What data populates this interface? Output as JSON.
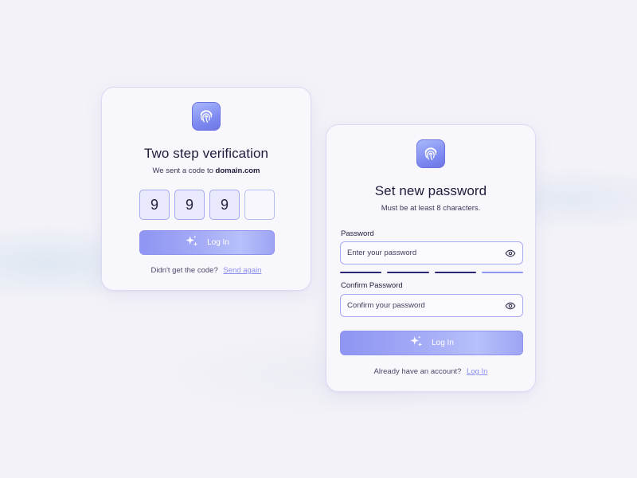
{
  "verify_card": {
    "icon": "fingerprint-icon",
    "title": "Two step verification",
    "subtitle_prefix": "We sent a code to",
    "subtitle_domain": "domain.com",
    "code_digits": [
      "9",
      "9",
      "9",
      ""
    ],
    "button_label": "Log In",
    "footer_text": "Didn't get the code?",
    "footer_link": "Send again"
  },
  "password_card": {
    "icon": "fingerprint-icon",
    "title": "Set new password",
    "subtitle": "Must be at least 8 characters.",
    "password_label": "Password",
    "password_placeholder": "Enter your password",
    "confirm_label": "Confirm Password",
    "confirm_placeholder": "Confirm your password",
    "strength_segments_filled": 3,
    "strength_segments_total": 4,
    "button_label": "Log In",
    "footer_text": "Already have an account?",
    "footer_link": "Log In"
  },
  "colors": {
    "accent": "#8a8ef0",
    "strength_strong": "#2a2575",
    "strength_weak": "#8f98f2"
  }
}
